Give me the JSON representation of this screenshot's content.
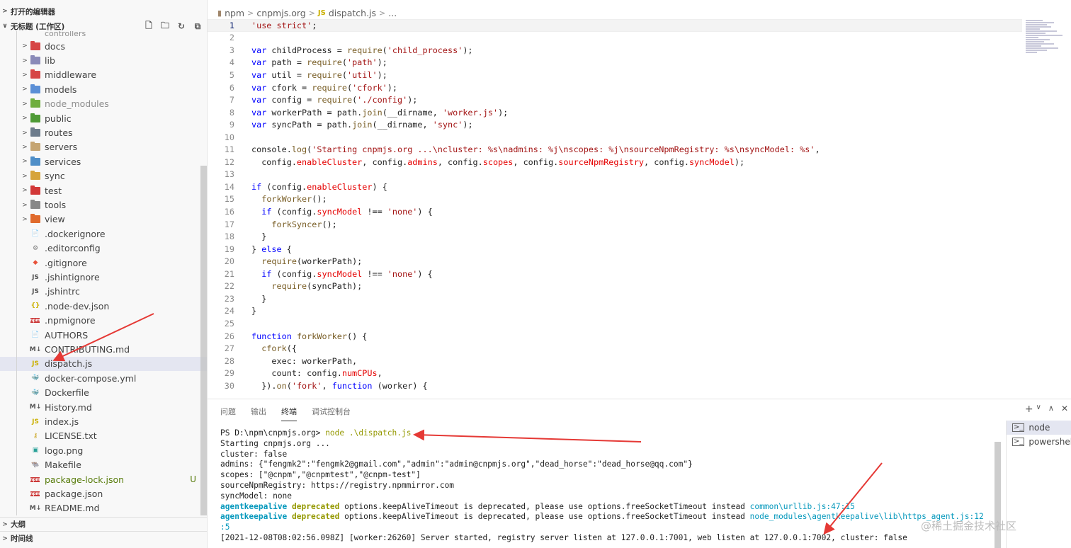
{
  "sidebar": {
    "open_editors_label": "打开的编辑器",
    "workspace_label": "无标题 (工作区)",
    "outline_label": "大纲",
    "timeline_label": "时间线",
    "partial_item": "controllers",
    "items": [
      {
        "name": "docs",
        "kind": "folder",
        "color": "#d64545"
      },
      {
        "name": "lib",
        "kind": "folder",
        "color": "#8a8ab8"
      },
      {
        "name": "middleware",
        "kind": "folder",
        "color": "#d64545"
      },
      {
        "name": "models",
        "kind": "folder",
        "color": "#5b8fd6"
      },
      {
        "name": "node_modules",
        "kind": "folder",
        "color": "#6fae3f",
        "dim": true
      },
      {
        "name": "public",
        "kind": "folder",
        "color": "#4e9a36"
      },
      {
        "name": "routes",
        "kind": "folder",
        "color": "#6d7c8c"
      },
      {
        "name": "servers",
        "kind": "folder",
        "color": "#c5a572"
      },
      {
        "name": "services",
        "kind": "folder",
        "color": "#4f8fc8"
      },
      {
        "name": "sync",
        "kind": "folder",
        "color": "#d6a43a"
      },
      {
        "name": "test",
        "kind": "folder",
        "color": "#d23838"
      },
      {
        "name": "tools",
        "kind": "folder",
        "color": "#888888"
      },
      {
        "name": "view",
        "kind": "folder",
        "color": "#e06a2c"
      },
      {
        "name": ".dockerignore",
        "kind": "file",
        "icon": "📄",
        "icon_color": "#9e9e9e"
      },
      {
        "name": ".editorconfig",
        "kind": "file",
        "icon": "⚙",
        "icon_color": "#777777"
      },
      {
        "name": ".gitignore",
        "kind": "file",
        "icon": "◆",
        "icon_color": "#e8523a"
      },
      {
        "name": ".jshintignore",
        "kind": "file",
        "icon": "JS",
        "icon_color": "#555555"
      },
      {
        "name": ".jshintrc",
        "kind": "file",
        "icon": "JS",
        "icon_color": "#555555"
      },
      {
        "name": ".node-dev.json",
        "kind": "file",
        "icon": "{}",
        "icon_color": "#cbb000"
      },
      {
        "name": ".npmignore",
        "kind": "file",
        "icon": "npm",
        "icon_color": "#cb3837"
      },
      {
        "name": "AUTHORS",
        "kind": "file",
        "icon": "📄",
        "icon_color": "#9e9e9e"
      },
      {
        "name": "CONTRIBUTING.md",
        "kind": "file",
        "icon": "M↓",
        "icon_color": "#555555"
      },
      {
        "name": "dispatch.js",
        "kind": "file",
        "icon": "JS",
        "icon_color": "#cbb000",
        "selected": true
      },
      {
        "name": "docker-compose.yml",
        "kind": "file",
        "icon": "🐳",
        "icon_color": "#2496ed"
      },
      {
        "name": "Dockerfile",
        "kind": "file",
        "icon": "🐳",
        "icon_color": "#2496ed"
      },
      {
        "name": "History.md",
        "kind": "file",
        "icon": "M↓",
        "icon_color": "#555555"
      },
      {
        "name": "index.js",
        "kind": "file",
        "icon": "JS",
        "icon_color": "#cbb000"
      },
      {
        "name": "LICENSE.txt",
        "kind": "file",
        "icon": "⚷",
        "icon_color": "#c9a21b"
      },
      {
        "name": "logo.png",
        "kind": "file",
        "icon": "▣",
        "icon_color": "#2aa198"
      },
      {
        "name": "Makefile",
        "kind": "file",
        "icon": "🐃",
        "icon_color": "#555555"
      },
      {
        "name": "package-lock.json",
        "kind": "file",
        "icon": "npm",
        "icon_color": "#cb3837",
        "badge": "U",
        "green": true
      },
      {
        "name": "package.json",
        "kind": "file",
        "icon": "npm",
        "icon_color": "#cb3837"
      },
      {
        "name": "README.md",
        "kind": "file",
        "icon": "M↓",
        "icon_color": "#555555"
      }
    ]
  },
  "breadcrumb": {
    "parts": [
      "npm",
      "cnpmjs.org"
    ],
    "file_icon": "JS",
    "file": "dispatch.js",
    "tail": "..."
  },
  "code_lines": [
    "'use strict';",
    "",
    "var childProcess = require('child_process');",
    "var path = require('path');",
    "var util = require('util');",
    "var cfork = require('cfork');",
    "var config = require('./config');",
    "var workerPath = path.join(__dirname, 'worker.js');",
    "var syncPath = path.join(__dirname, 'sync');",
    "",
    "console.log('Starting cnpmjs.org ...\\ncluster: %s\\nadmins: %j\\nscopes: %j\\nsourceNpmRegistry: %s\\nsyncModel: %s',",
    "  config.enableCluster, config.admins, config.scopes, config.sourceNpmRegistry, config.syncModel);",
    "",
    "if (config.enableCluster) {",
    "  forkWorker();",
    "  if (config.syncModel !== 'none') {",
    "    forkSyncer();",
    "  }",
    "} else {",
    "  require(workerPath);",
    "  if (config.syncModel !== 'none') {",
    "    require(syncPath);",
    "  }",
    "}",
    "",
    "function forkWorker() {",
    "  cfork({",
    "    exec: workerPath,",
    "    count: config.numCPUs,",
    "  }).on('fork', function (worker) {"
  ],
  "panel": {
    "tabs": [
      "问题",
      "输出",
      "终端",
      "调试控制台"
    ],
    "active_tab": "终端",
    "actions": [
      "+",
      "∨",
      "∧",
      "✕"
    ],
    "terminals": [
      {
        "label": "node",
        "active": true
      },
      {
        "label": "powershell",
        "active": false
      }
    ],
    "terminal": {
      "prompt": "PS D:\\npm\\cnpmjs.org> ",
      "command": "node .\\dispatch.js",
      "lines": [
        "Starting cnpmjs.org ...",
        "cluster: false",
        "admins: {\"fengmk2\":\"fengmk2@gmail.com\",\"admin\":\"admin@cnpmjs.org\",\"dead_horse\":\"dead_horse@qq.com\"}",
        "scopes: [\"@cnpm\",\"@cnpmtest\",\"@cnpm-test\"]",
        "sourceNpmRegistry: https://registry.npmmirror.com",
        "syncModel: none"
      ],
      "deprecation_1": {
        "a": "agentkeepalive",
        "b": "deprecated",
        "msg": " options.keepAliveTimeout is deprecated, please use options.freeSocketTimeout instead ",
        "link": "common\\urllib.js:47:15"
      },
      "deprecation_2": {
        "a": "agentkeepalive",
        "b": "deprecated",
        "msg": " options.keepAliveTimeout is deprecated, please use options.freeSocketTimeout instead ",
        "link": "node_modules\\agentkeepalive\\lib\\https_agent.js:12",
        "link_cont": ":5"
      },
      "server_line": "[2021-12-08T08:02:56.098Z] [worker:26260] Server started, registry server listen at 127.0.0.1:7001, web listen at 127.0.0.1:7002, cluster: false"
    }
  },
  "watermark": "@稀土掘金技术社区",
  "colors": {
    "accent": "#0000ff",
    "string": "#a31515",
    "property": "#e50000",
    "function": "#795e26",
    "annotation_arrow": "#e53935"
  }
}
